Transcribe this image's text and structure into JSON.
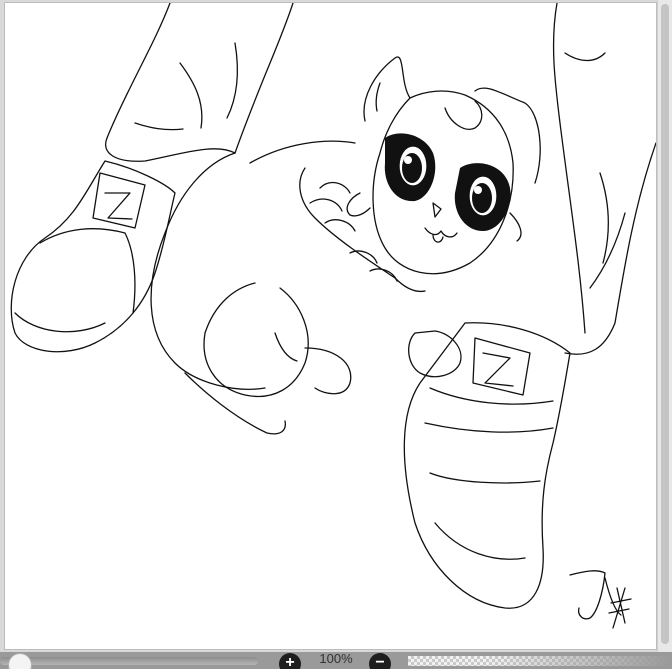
{
  "canvas": {
    "drawing_subject": "cat-between-sneakers-lineart",
    "signature": "Joy"
  },
  "toolbar": {
    "zoom_level": "100%",
    "zoom_in_symbol": "+",
    "zoom_out_symbol": "−",
    "brush_size_fraction": 0.02
  },
  "colors": {
    "canvas_bg": "#ffffff",
    "frame_bg": "#d9d9d9",
    "toolbar_bg": "#9a9a9a",
    "ink": "#111111"
  }
}
